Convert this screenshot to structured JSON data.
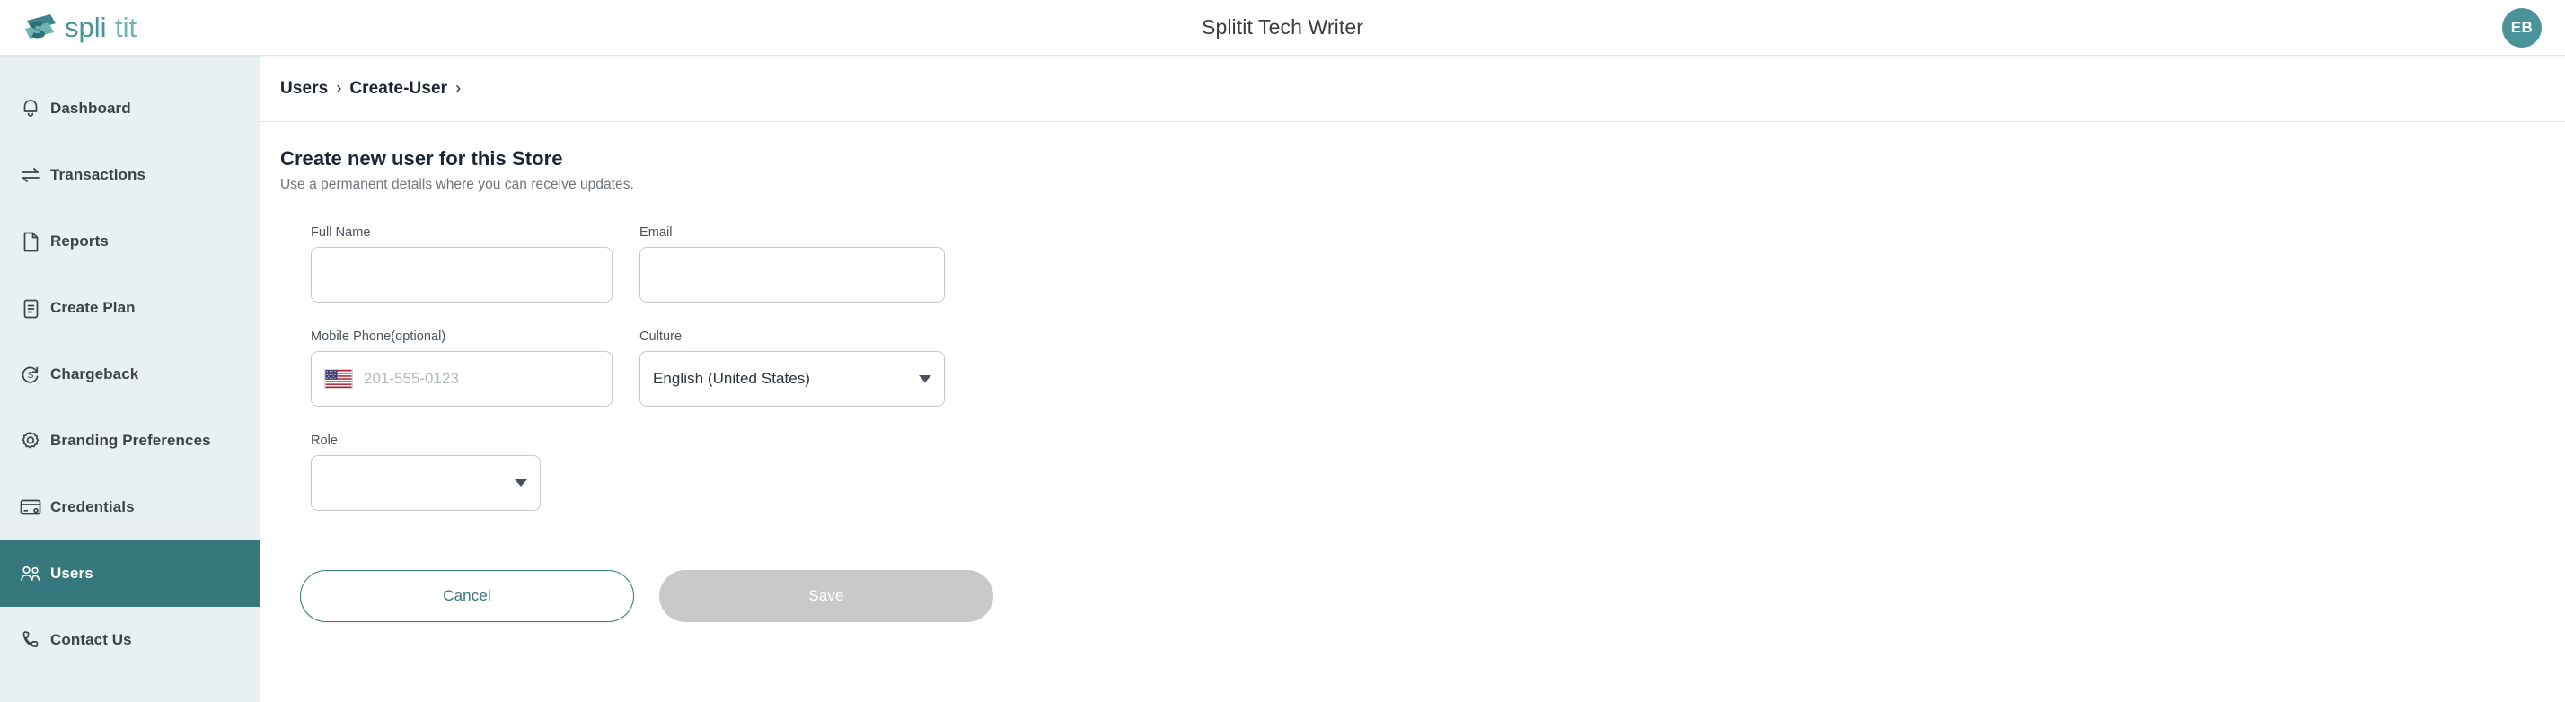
{
  "header": {
    "title": "Splitit Tech Writer",
    "logo_text": "splitit",
    "avatar_initials": "EB"
  },
  "sidebar": {
    "items": [
      {
        "label": "Dashboard",
        "icon": "bell-icon",
        "active": false
      },
      {
        "label": "Transactions",
        "icon": "transfer-icon",
        "active": false
      },
      {
        "label": "Reports",
        "icon": "document-icon",
        "active": false
      },
      {
        "label": "Create Plan",
        "icon": "clipboard-icon",
        "active": false
      },
      {
        "label": "Chargeback",
        "icon": "refund-icon",
        "active": false
      },
      {
        "label": "Branding Preferences",
        "icon": "gear-icon",
        "active": false
      },
      {
        "label": "Credentials",
        "icon": "card-icon",
        "active": false
      },
      {
        "label": "Users",
        "icon": "users-icon",
        "active": true
      },
      {
        "label": "Contact Us",
        "icon": "phone-icon",
        "active": false
      }
    ]
  },
  "breadcrumb": {
    "items": [
      "Users",
      "Create-User"
    ],
    "separator": "›"
  },
  "main": {
    "page_title": "Create new user for this Store",
    "page_subtitle": "Use a permanent details where you can receive updates.",
    "form": {
      "full_name": {
        "label": "Full Name",
        "value": "",
        "placeholder": ""
      },
      "email": {
        "label": "Email",
        "value": "",
        "placeholder": ""
      },
      "mobile_phone": {
        "label": "Mobile Phone(optional)",
        "value": "",
        "placeholder": "201-555-0123",
        "country_flag": "us-flag-icon"
      },
      "culture": {
        "label": "Culture",
        "value": "English (United States)"
      },
      "role": {
        "label": "Role",
        "value": ""
      }
    },
    "actions": {
      "cancel_label": "Cancel",
      "save_label": "Save",
      "save_disabled": true
    }
  },
  "colors": {
    "brand_teal": "#35777d",
    "logo_teal": "#4a9398",
    "sidebar_bg": "#e9f0f1",
    "text_dark": "#1c2433",
    "text_muted": "#6e757d",
    "disabled_gray": "#c8c9ca"
  }
}
